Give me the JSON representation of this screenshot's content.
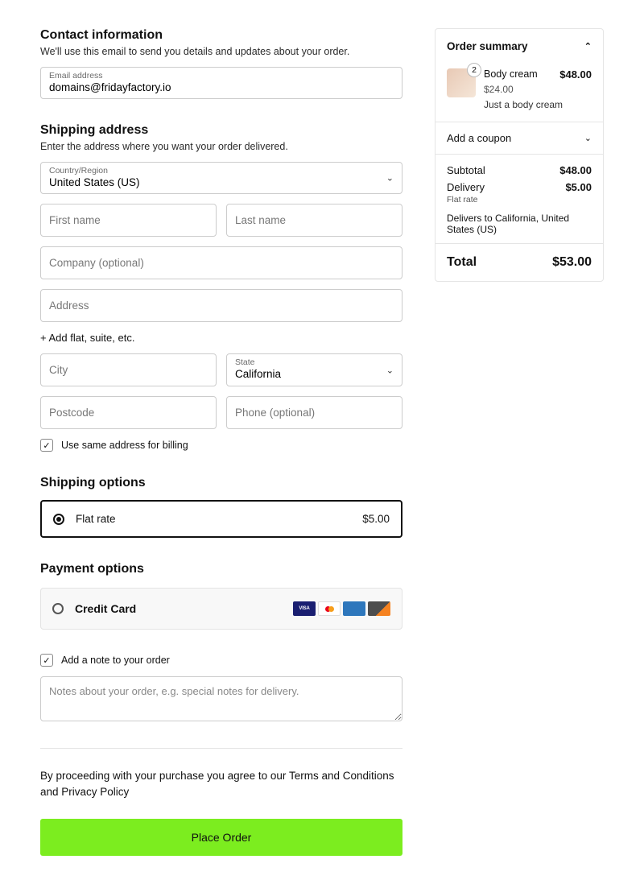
{
  "contact": {
    "heading": "Contact information",
    "desc": "We'll use this email to send you details and updates about your order.",
    "email_label": "Email address",
    "email_value": "domains@fridayfactory.io"
  },
  "shipping": {
    "heading": "Shipping address",
    "desc": "Enter the address where you want your order delivered.",
    "country_label": "Country/Region",
    "country_value": "United States (US)",
    "first_name_ph": "First name",
    "last_name_ph": "Last name",
    "company_ph": "Company (optional)",
    "address_ph": "Address",
    "add_flat": "+ Add flat, suite, etc.",
    "city_ph": "City",
    "state_label": "State",
    "state_value": "California",
    "postcode_ph": "Postcode",
    "phone_ph": "Phone (optional)",
    "same_billing": "Use same address for billing"
  },
  "ship_options": {
    "heading": "Shipping options",
    "flat_label": "Flat rate",
    "flat_price": "$5.00"
  },
  "payment": {
    "heading": "Payment options",
    "credit_label": "Credit Card"
  },
  "note": {
    "check_label": "Add a note to your order",
    "placeholder": "Notes about your order, e.g. special notes for delivery."
  },
  "terms": {
    "text_a": "By proceeding with your purchase you agree to our ",
    "terms_link": "Terms and Conditions",
    "and": " and ",
    "privacy_link": "Privacy Policy"
  },
  "place_order": "Place Order",
  "summary": {
    "heading": "Order summary",
    "item": {
      "qty": "2",
      "name": "Body cream",
      "price": "$48.00",
      "unit": "$24.00",
      "desc": "Just a body cream"
    },
    "coupon": "Add a coupon",
    "subtotal_label": "Subtotal",
    "subtotal_value": "$48.00",
    "delivery_label": "Delivery",
    "delivery_value": "$5.00",
    "delivery_method": "Flat rate",
    "delivers_to": "Delivers to California, United States (US)",
    "total_label": "Total",
    "total_value": "$53.00"
  }
}
